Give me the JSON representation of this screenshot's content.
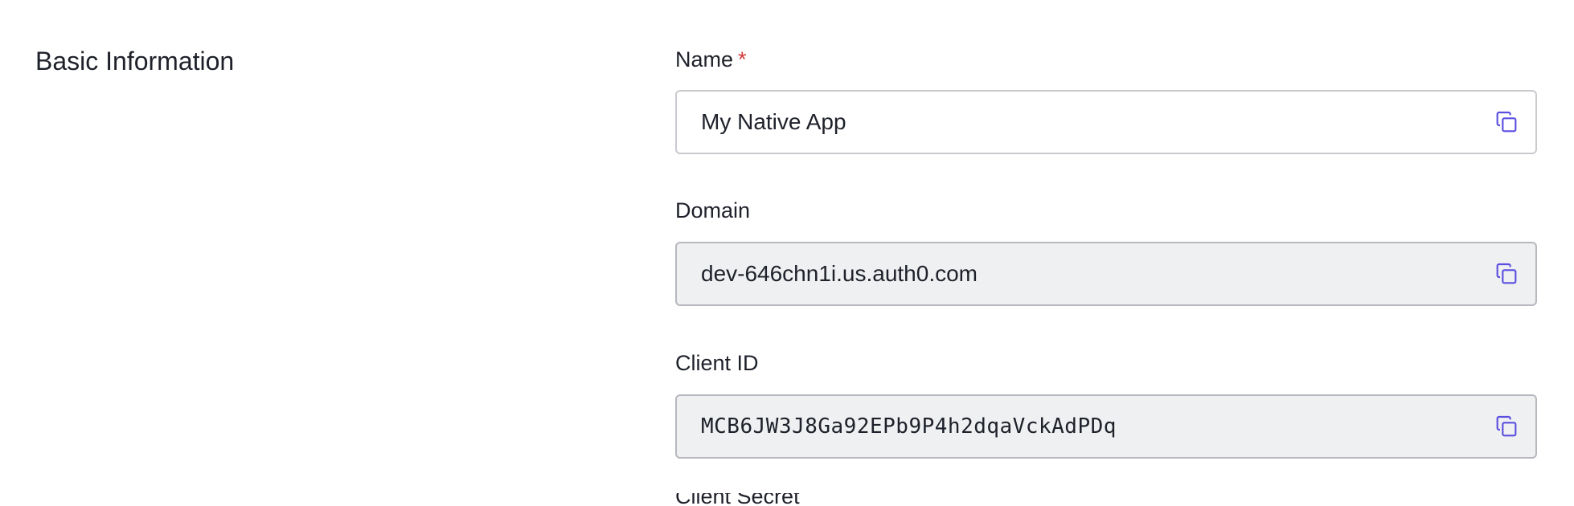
{
  "section": {
    "title": "Basic Information"
  },
  "fields": {
    "name": {
      "label": "Name",
      "required_mark": "*",
      "value": "My Native App",
      "copy_icon": "copy-icon"
    },
    "domain": {
      "label": "Domain",
      "value": "dev-646chn1i.us.auth0.com",
      "copy_icon": "copy-icon"
    },
    "client_id": {
      "label": "Client ID",
      "value": "MCB6JW3J8Ga92EPb9P4h2dqaVckAdPDq",
      "copy_icon": "copy-icon"
    },
    "next": {
      "label": "Client Secret"
    }
  },
  "colors": {
    "accent": "#5b4fe0",
    "required": "#d03c38",
    "readonly_bg": "#eff0f2",
    "border": "#c9cace",
    "text": "#1e212a"
  }
}
